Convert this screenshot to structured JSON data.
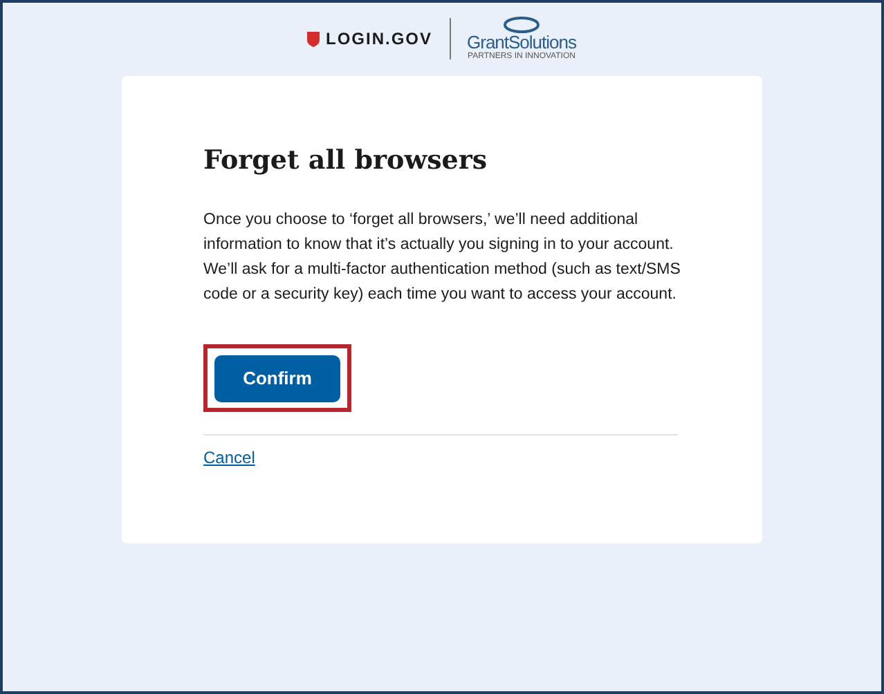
{
  "header": {
    "login_logo": "LOGIN.GOV",
    "partner_logo": "GrantSolutions",
    "partner_tagline": "PARTNERS IN INNOVATION"
  },
  "card": {
    "title": "Forget all browsers",
    "body": "Once you choose to ‘forget all browsers,’ we’ll need additional information to know that it’s actually you signing in to your account. We’ll ask for a multi-factor authentication method (such as text/SMS code or a security key) each time you want to access your account.",
    "confirm_button": {
      "label": "Confirm",
      "highlighted": true
    },
    "cancel_link": "Cancel"
  }
}
